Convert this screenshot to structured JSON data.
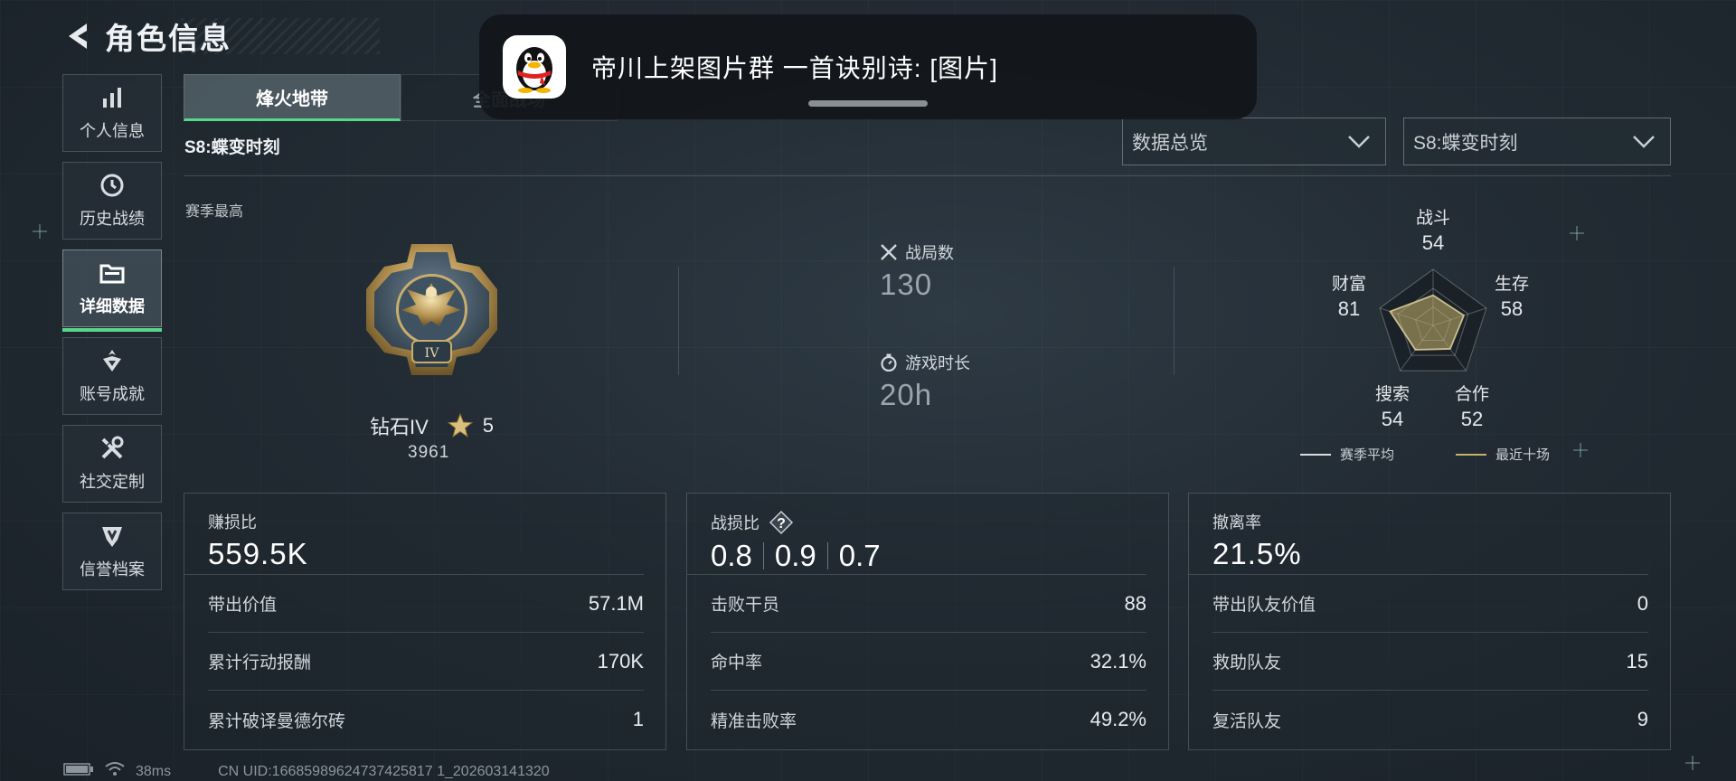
{
  "header": {
    "title": "角色信息"
  },
  "sidebar": {
    "items": [
      {
        "label": "个人信息",
        "icon": "bar-chart-icon",
        "active": false
      },
      {
        "label": "历史战绩",
        "icon": "history-icon",
        "active": false
      },
      {
        "label": "详细数据",
        "icon": "folder-icon",
        "active": true
      },
      {
        "label": "账号成就",
        "icon": "achievement-icon",
        "active": false
      },
      {
        "label": "社交定制",
        "icon": "tools-icon",
        "active": false
      },
      {
        "label": "信誉档案",
        "icon": "shield-icon",
        "active": false
      }
    ]
  },
  "tabs": [
    {
      "label": "烽火地带",
      "active": true
    },
    {
      "label": "全面战场",
      "active": false
    }
  ],
  "season": {
    "title": "S8:蝶变时刻",
    "best_label": "赛季最高"
  },
  "filters": {
    "view": "数据总览",
    "season": "S8:蝶变时刻"
  },
  "rank": {
    "name": "钻石IV",
    "stars": "5",
    "score": "3961",
    "badge_numeral": "IV"
  },
  "stats": {
    "matches_label": "战局数",
    "matches_value": "130",
    "playtime_label": "游戏时长",
    "playtime_value": "20h"
  },
  "radar": {
    "axes": [
      {
        "label": "战斗",
        "value": "54"
      },
      {
        "label": "生存",
        "value": "58"
      },
      {
        "label": "合作",
        "value": "52"
      },
      {
        "label": "搜索",
        "value": "54"
      },
      {
        "label": "财富",
        "value": "81"
      }
    ],
    "legend": {
      "season_avg": "赛季平均",
      "recent10": "最近十场"
    },
    "colors": {
      "season_avg": "#d9dde0",
      "recent10": "#c8b26a"
    }
  },
  "cards": {
    "profit": {
      "title": "赚损比",
      "value": "559.5K",
      "rows": [
        {
          "label": "带出价值",
          "value": "57.1M"
        },
        {
          "label": "累计行动报酬",
          "value": "170K"
        },
        {
          "label": "累计破译曼德尔砖",
          "value": "1"
        }
      ]
    },
    "combat": {
      "title": "战损比",
      "help": "?",
      "ratios": [
        "0.8",
        "0.9",
        "0.7"
      ],
      "rows": [
        {
          "label": "击败干员",
          "value": "88"
        },
        {
          "label": "命中率",
          "value": "32.1%"
        },
        {
          "label": "精准击败率",
          "value": "49.2%"
        }
      ]
    },
    "extract": {
      "title": "撤离率",
      "value": "21.5%",
      "rows": [
        {
          "label": "带出队友价值",
          "value": "0"
        },
        {
          "label": "救助队友",
          "value": "15"
        },
        {
          "label": "复活队友",
          "value": "9"
        }
      ]
    }
  },
  "status": {
    "ping": "38ms",
    "uid": "CN UID:16685989624737425817 1_202603141320"
  },
  "notification": {
    "text": "帝川上架图片群  一首诀别诗: [图片]",
    "app_icon": "qq-penguin-icon"
  },
  "accent": "#58d68a"
}
